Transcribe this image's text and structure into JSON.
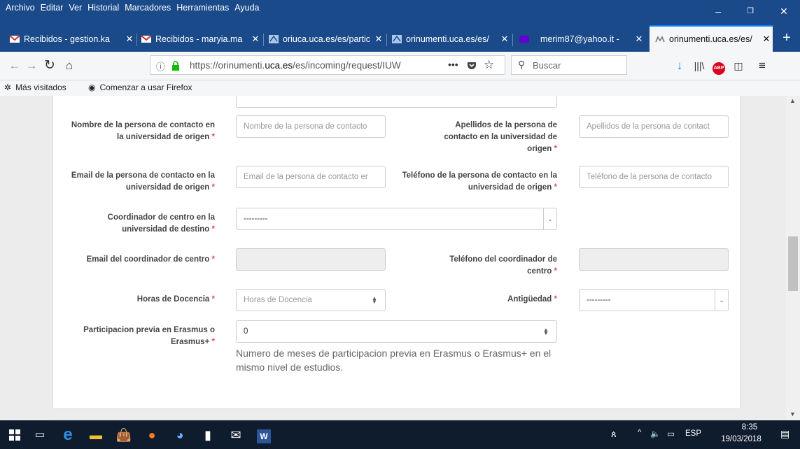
{
  "menu": [
    "Archivo",
    "Editar",
    "Ver",
    "Historial",
    "Marcadores",
    "Herramientas",
    "Ayuda"
  ],
  "tabs": [
    {
      "label": "Recibidos - gestion.ka",
      "icon": "gmail-icon"
    },
    {
      "label": "Recibidos - maryia.ma",
      "icon": "gmail-icon"
    },
    {
      "label": "oriuca.uca.es/es/partic",
      "icon": "uca-icon"
    },
    {
      "label": "orinumenti.uca.es/es/",
      "icon": "uca-icon"
    },
    {
      "label": "merim87@yahoo.it -",
      "icon": "yahoo-icon"
    },
    {
      "label": "orinumenti.uca.es/es/",
      "icon": "uca-icon"
    }
  ],
  "url": {
    "prefix": "https://orinumenti.",
    "domain": "uca.es",
    "suffix": "/es/incoming/request/IUW"
  },
  "search": {
    "placeholder": "Buscar"
  },
  "bookmarks": {
    "most_visited": "Más visitados",
    "getting_started": "Comenzar a usar Firefox"
  },
  "form": {
    "contact_name_label": "Nombre de la persona de contacto en la universidad de origen",
    "contact_name_placeholder": "Nombre de la persona de contacto",
    "contact_surname_label": "Apellidos de la persona de contacto en la universidad de origen",
    "contact_surname_placeholder": "Apellidos de la persona de contact",
    "contact_email_label": "Email de la persona de contacto en la universidad de origen",
    "contact_email_placeholder": "Email de la persona de contacto er",
    "contact_phone_label": "Teléfono de la persona de contacto en la universidad de origen",
    "contact_phone_placeholder": "Teléfono de la persona de contacto",
    "coordinator_label": "Coordinador de centro en la universidad de destino",
    "coordinator_value": "---------",
    "coord_email_label": "Email del coordinador de centro",
    "coord_phone_label": "Teléfono del coordinador de centro",
    "hours_label": "Horas de Docencia",
    "hours_placeholder": "Horas de Docencia",
    "seniority_label": "Antigüedad",
    "seniority_value": "---------",
    "erasmus_label": "Participacion previa en Erasmus o Erasmus+",
    "erasmus_value": "0",
    "erasmus_help": "Numero de meses de participacion previa en Erasmus o Erasmus+ en el mismo nivel de estudios.",
    "required_mark": "*"
  },
  "tray": {
    "lang": "ESP",
    "time": "8:35",
    "date": "19/03/2018"
  },
  "colors": {
    "chrome": "#1a4a8a",
    "required": "#d9534f",
    "accent": "#0a84ff"
  }
}
